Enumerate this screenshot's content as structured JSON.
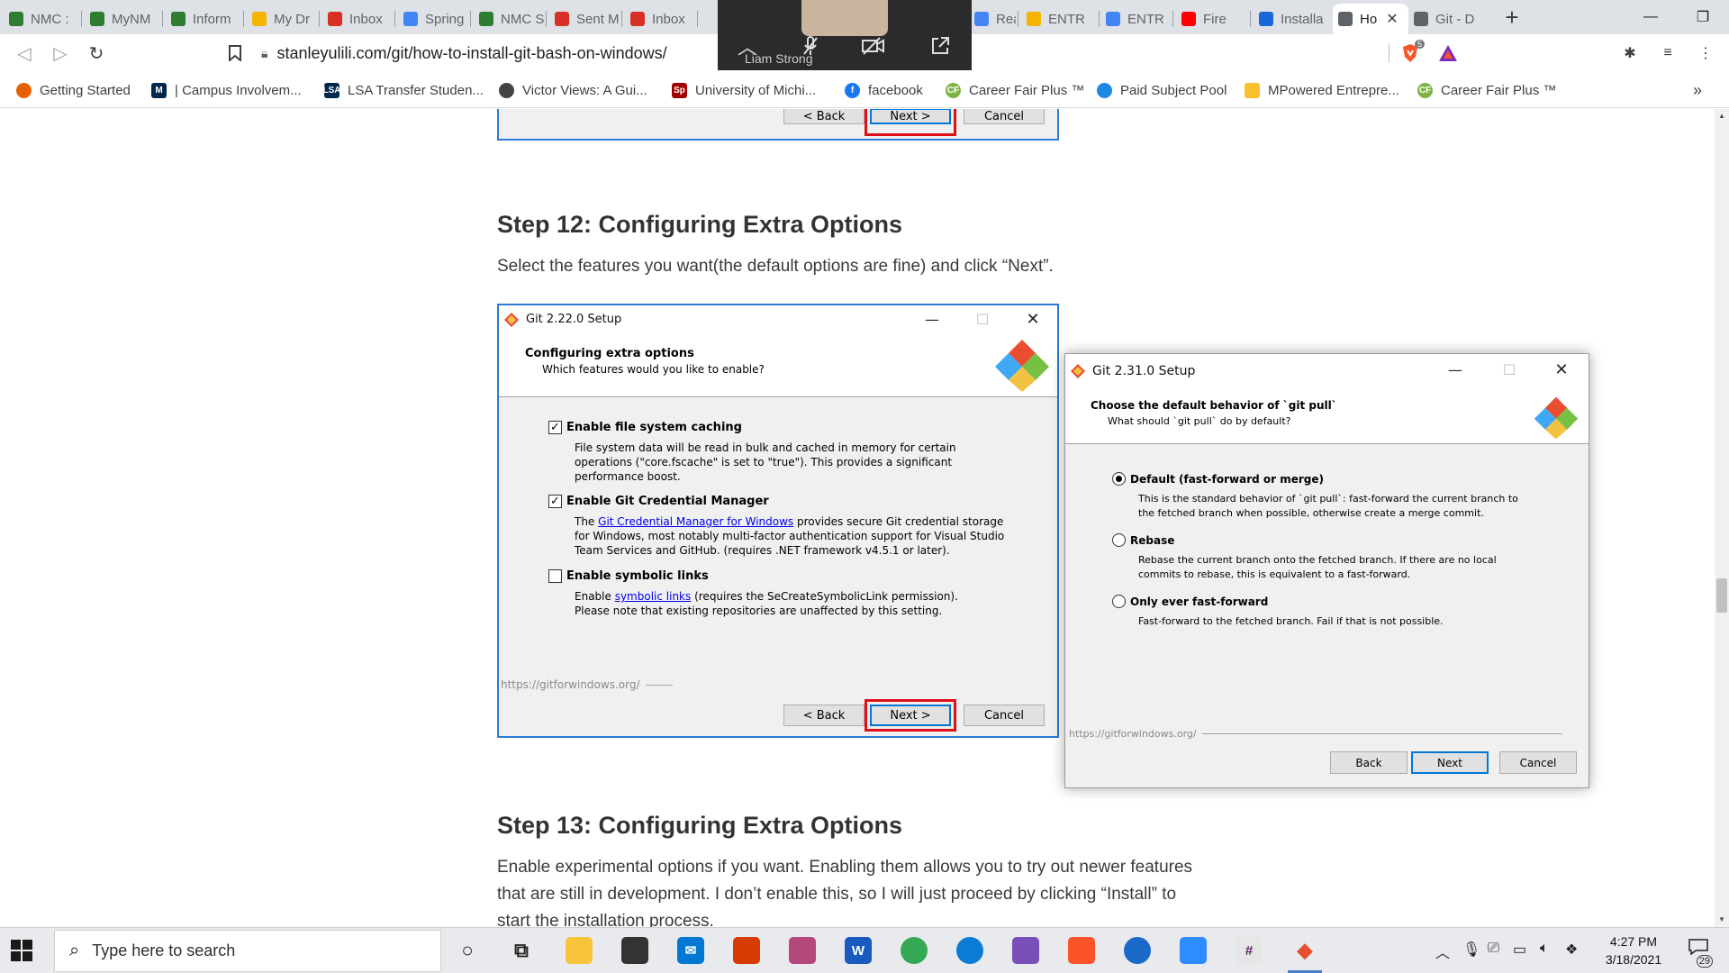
{
  "browser": {
    "tabs": [
      {
        "label": "NMC :",
        "icon": "nmc-icon",
        "color": "#2e7d32"
      },
      {
        "label": "MyNM",
        "icon": "nmc-icon",
        "color": "#2e7d32"
      },
      {
        "label": "Inform",
        "icon": "nmc-icon",
        "color": "#2e7d32"
      },
      {
        "label": "My Dr",
        "icon": "drive-icon",
        "color": "#f4b400"
      },
      {
        "label": "Inbox",
        "icon": "gmail-icon",
        "color": "#d93025"
      },
      {
        "label": "Spring",
        "icon": "docs-icon",
        "color": "#4285f4"
      },
      {
        "label": "NMC S",
        "icon": "nmc-icon",
        "color": "#2e7d32"
      },
      {
        "label": "Sent M",
        "icon": "gmail-icon",
        "color": "#d93025"
      },
      {
        "label": "Inbox",
        "icon": "gmail-icon",
        "color": "#d93025"
      },
      {
        "label": "Readin",
        "icon": "docs-icon",
        "color": "#4285f4"
      },
      {
        "label": "ENTR",
        "icon": "drive-icon",
        "color": "#f4b400"
      },
      {
        "label": "ENTR",
        "icon": "docs-icon",
        "color": "#4285f4"
      },
      {
        "label": "Fire",
        "icon": "youtube-icon",
        "color": "#ff0000"
      },
      {
        "label": "Installa",
        "icon": "confluence-icon",
        "color": "#1868db"
      },
      {
        "label": "Ho",
        "icon": "globe-icon",
        "color": "#5f6368",
        "active": true
      },
      {
        "label": "Git - D",
        "icon": "globe-icon",
        "color": "#5f6368"
      }
    ],
    "new_tab": "+",
    "window_controls": {
      "minimize": "—",
      "restore": "❐",
      "close": "✕"
    },
    "url": "stanleyulili.com/git/how-to-install-git-bash-on-windows/",
    "brave_badge": "5",
    "bookmarks": [
      {
        "label": "Getting Started",
        "icon": "firefox-icon",
        "color": "#e66000",
        "glyph": ""
      },
      {
        "label": "| Campus Involvem...",
        "icon": "michigan-icon",
        "color": "#00274c",
        "glyph": "M"
      },
      {
        "label": "LSA Transfer Studen...",
        "icon": "lsa-icon",
        "color": "#00274c",
        "glyph": "LSA"
      },
      {
        "label": "Victor Views: A Gui...",
        "icon": "globe-icon",
        "color": "#444444",
        "glyph": ""
      },
      {
        "label": "University of Michi...",
        "icon": "umich-icon",
        "color": "#a00000",
        "glyph": "Sp"
      },
      {
        "label": "facebook",
        "icon": "facebook-icon",
        "color": "#1877f2",
        "glyph": "f"
      },
      {
        "label": "Career Fair Plus ™",
        "icon": "careerfair-icon",
        "color": "#7cb342",
        "glyph": "CF"
      },
      {
        "label": "Paid Subject Pool",
        "icon": "subjectpool-icon",
        "color": "#1e88e5",
        "glyph": ""
      },
      {
        "label": "MPowered Entrepre...",
        "icon": "mpowered-icon",
        "color": "#fbc02d",
        "glyph": ""
      },
      {
        "label": "Career Fair Plus ™",
        "icon": "careerfair-icon",
        "color": "#7cb342",
        "glyph": "CF"
      }
    ],
    "bookmarks_overflow": "»"
  },
  "video_overlay": {
    "participant_name": "Liam Strong"
  },
  "page": {
    "step12_title": "Step 12: Configuring Extra Options",
    "step12_desc": "Select the features you want(the default options are fine) and click “Next”.",
    "step13_title": "Step 13: Configuring Extra Options",
    "step13_desc": "Enable experimental options if you want. Enabling them allows you to try out newer features that are still in development. I don’t enable this, so I will just proceed by clicking “Install” to start the installation process."
  },
  "prev_screenshot": {
    "back": "< Back",
    "next": "Next >",
    "cancel": "Cancel"
  },
  "setup_222": {
    "title": "Git 2.22.0 Setup",
    "header": "Configuring extra options",
    "subheader": "Which features would you like to enable?",
    "options": [
      {
        "label": "Enable file system caching",
        "checked": true,
        "desc_lines": [
          "File system data will be read in bulk and cached in memory for certain",
          "operations (\"core.fscache\" is set to \"true\"). This provides a significant",
          "performance boost."
        ]
      },
      {
        "label": "Enable Git Credential Manager",
        "checked": true,
        "desc_pre": "The ",
        "desc_link": "Git Credential Manager for Windows",
        "desc_post": " provides secure Git credential storage",
        "desc_lines": [
          "for Windows, most notably multi-factor authentication support for Visual Studio",
          "Team Services and GitHub. (requires .NET framework v4.5.1 or later)."
        ]
      },
      {
        "label": "Enable symbolic links",
        "checked": false,
        "desc_pre": "Enable ",
        "desc_link": "symbolic links",
        "desc_post": " (requires the SeCreateSymbolicLink permission).",
        "desc_lines": [
          "Please note that existing repositories are unaffected by this setting."
        ]
      }
    ],
    "footer_url": "https://gitforwindows.org/",
    "back": "< Back",
    "next": "Next >",
    "cancel": "Cancel"
  },
  "setup_231": {
    "title": "Git 2.31.0 Setup",
    "header": "Choose the default behavior of `git pull`",
    "subheader": "What should `git pull` do by default?",
    "options": [
      {
        "label": "Default (fast-forward or merge)",
        "selected": true,
        "desc_lines": [
          "This is the standard behavior of `git pull`: fast-forward the current branch to",
          "the fetched branch when possible, otherwise create a merge commit."
        ]
      },
      {
        "label": "Rebase",
        "selected": false,
        "desc_lines": [
          "Rebase the current branch onto the fetched branch. If there are no local",
          "commits to rebase, this is equivalent to a fast-forward."
        ]
      },
      {
        "label": "Only ever fast-forward",
        "selected": false,
        "desc_lines": [
          "Fast-forward to the fetched branch. Fail if that is not possible."
        ]
      }
    ],
    "footer_url": "https://gitforwindows.org/",
    "back": "Back",
    "next": "Next",
    "cancel": "Cancel"
  },
  "taskbar": {
    "search_placeholder": "Type here to search",
    "apps": [
      {
        "name": "cortana-icon",
        "glyph": "○",
        "bg": "transparent",
        "fg": "#222222"
      },
      {
        "name": "task-view-icon",
        "glyph": "⧉",
        "bg": "transparent",
        "fg": "#222222"
      },
      {
        "name": "file-explorer-icon",
        "glyph": "",
        "bg": "#f8c43a",
        "fg": "#ffffff"
      },
      {
        "name": "store-icon",
        "glyph": "",
        "bg": "#333333",
        "fg": "#ffffff"
      },
      {
        "name": "mail-icon",
        "glyph": "✉",
        "bg": "#0078d4",
        "fg": "#ffffff"
      },
      {
        "name": "office-icon",
        "glyph": "",
        "bg": "#d83b01",
        "fg": "#ffffff"
      },
      {
        "name": "snip-icon",
        "glyph": "",
        "bg": "#b4477c",
        "fg": "#ffffff"
      },
      {
        "name": "word-icon",
        "glyph": "W",
        "bg": "#185abd",
        "fg": "#ffffff"
      },
      {
        "name": "chrome-icon",
        "glyph": "",
        "bg": "#34a853",
        "fg": "#ffffff"
      },
      {
        "name": "edge-icon",
        "glyph": "",
        "bg": "#0c7bd6",
        "fg": "#ffffff"
      },
      {
        "name": "visual-studio-icon",
        "glyph": "",
        "bg": "#7b4fb8",
        "fg": "#ffffff"
      },
      {
        "name": "brave-icon",
        "glyph": "",
        "bg": "#fb542b",
        "fg": "#ffffff"
      },
      {
        "name": "git-gui-icon",
        "glyph": "",
        "bg": "#1b6ac9",
        "fg": "#ffffff"
      },
      {
        "name": "zoom-icon",
        "glyph": "",
        "bg": "#2d8cff",
        "fg": "#ffffff"
      },
      {
        "name": "slack-icon",
        "glyph": "#",
        "bg": "#e6e6e6",
        "fg": "#611f69"
      },
      {
        "name": "git-setup-icon",
        "glyph": "◆",
        "bg": "transparent",
        "fg": "#e94e31",
        "active": true
      }
    ],
    "time": "4:27 PM",
    "date": "3/18/2021",
    "notification_count": "29"
  },
  "colors": {
    "accent_blue": "#0078d7",
    "highlight_red": "#e0101a",
    "frame_blue": "#2b79d8"
  }
}
